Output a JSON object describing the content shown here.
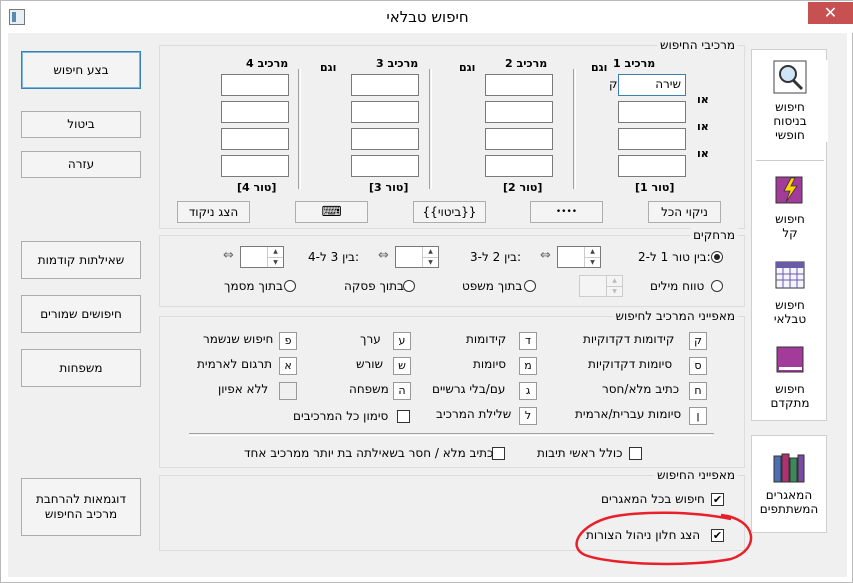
{
  "window": {
    "title": "חיפוש טבלאי",
    "close": "✕"
  },
  "left_buttons": {
    "execute": "בצע חיפוש",
    "cancel": "ביטול",
    "help": "עזרה",
    "prev_queries": "שאילתות קודמות",
    "saved": "חיפושים שמורים",
    "families": "משפחות",
    "examples": "דוגמאות להרחבת\nמרכיב החיפוש"
  },
  "components": {
    "legend": "מרכיבי החיפוש",
    "col1": "מרכיב 1",
    "col2": "מרכיב 2",
    "col3": "מרכיב 3",
    "col4": "מרכיב 4",
    "and": "וגם",
    "or": "או",
    "col1_value": "שירה",
    "col1_prefix": "ק",
    "tor1": "[טור 1]",
    "tor2": "[טור 2]",
    "tor3": "[טור 3]",
    "tor4": "[טור 4]",
    "clear_all": "ניקוי הכל",
    "btn_grammar": "••••",
    "btn_expr": "{{ביטוי}}",
    "btn_kbd": "⌨",
    "show_nikud": "הצג ניקוד"
  },
  "distances": {
    "legend": "מרחקים",
    "between12": "בין טור 1 ל-2:",
    "between23": "בין 2 ל-3:",
    "between34": "בין 3 ל-4:",
    "word_range": "טווח מילים",
    "in_sentence": "בתוך משפט",
    "in_paragraph": "בתוך פסקה",
    "in_document": "בתוך מסמך"
  },
  "features": {
    "legend": "מאפייני המרכיב לחיפוש",
    "items": [
      {
        "key": "ק",
        "label": "קידומות דקדוקיות"
      },
      {
        "key": "ד",
        "label": "קידומות"
      },
      {
        "key": "ע",
        "label": "ערך"
      },
      {
        "key": "פ",
        "label": "חיפוש שנשמר"
      },
      {
        "key": "ס",
        "label": "סיומות דקדוקיות"
      },
      {
        "key": "מ",
        "label": "סיומות"
      },
      {
        "key": "ש",
        "label": "שורש"
      },
      {
        "key": "א",
        "label": "תרגום לארמית"
      },
      {
        "key": "ח",
        "label": "כתיב מלא/חסר"
      },
      {
        "key": "ג",
        "label": "עם/בלי גרשיים"
      },
      {
        "key": "ה",
        "label": "משפחה"
      },
      {
        "key": "",
        "label": "ללא אפיון"
      },
      {
        "key": "ן",
        "label": "סיומות עברית/ארמית"
      },
      {
        "key": "ל",
        "label": "שלילת המרכיב"
      }
    ],
    "mark_all": "סימון כל המרכיבים",
    "include_acronyms": "כולל ראשי תיבות",
    "plene_multi": "כתיב מלא / חסר בשאילתה בת יותר ממרכיב אחד"
  },
  "search_props": {
    "legend": "מאפייני החיפוש",
    "all_repos": "חיפוש בכל המאגרים",
    "show_window": "הצג חלון ניהול הצורות"
  },
  "tabs": {
    "free": "חיפוש\nבניסוח\nחופשי",
    "easy": "חיפוש\nקל",
    "table": "חיפוש\nטבלאי",
    "advanced": "חיפוש\nמתקדם",
    "repos": "המאגרים\nהמשתתפים"
  },
  "colors": {
    "annotation": "#e8202a",
    "selected_btn": "#3c7fb1"
  }
}
